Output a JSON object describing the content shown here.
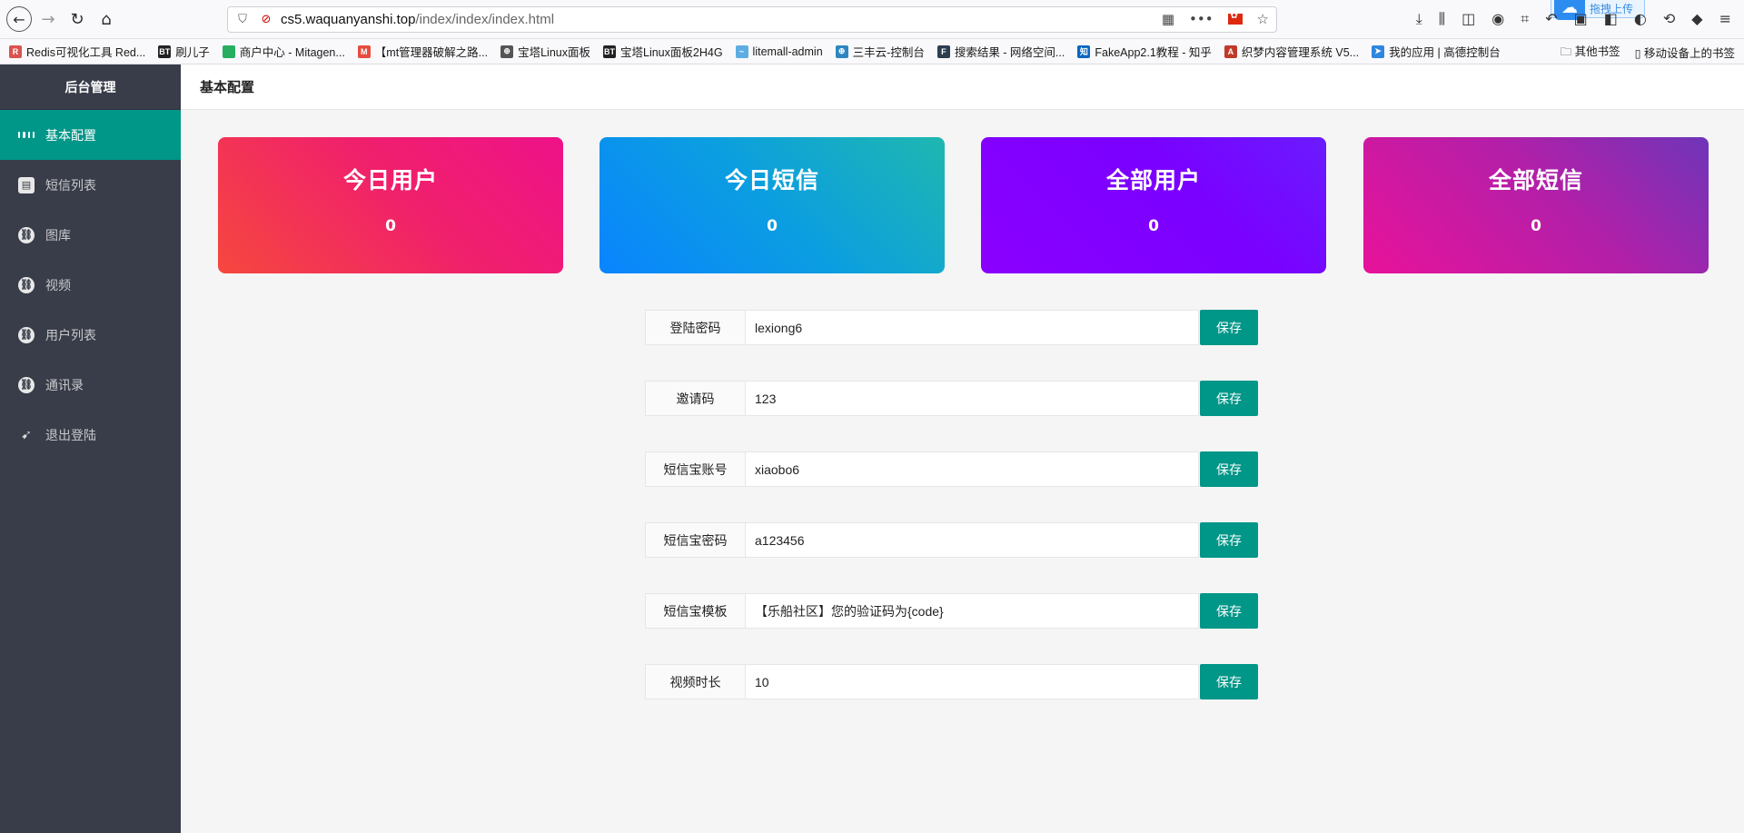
{
  "browser": {
    "url_host": "cs5.waquanyanshi.top",
    "url_path": "/index/index/index.html",
    "upload_chip": "拖拽上传"
  },
  "bookmarks": [
    {
      "label": "Redis可视化工具 Red...",
      "icon_color": "#d9534f",
      "icon_text": "R"
    },
    {
      "label": "刷儿子",
      "icon_color": "#222222",
      "icon_text": "BT"
    },
    {
      "label": "商户中心 - Mitagen...",
      "icon_color": "#27ae60",
      "icon_text": ""
    },
    {
      "label": "【mt管理器破解之路...",
      "icon_color": "#e74c3c",
      "icon_text": "M"
    },
    {
      "label": "宝塔Linux面板",
      "icon_color": "#555555",
      "icon_text": "⊕"
    },
    {
      "label": "宝塔Linux面板2H4G",
      "icon_color": "#222222",
      "icon_text": "BT"
    },
    {
      "label": "litemall-admin",
      "icon_color": "#5dade2",
      "icon_text": "~"
    },
    {
      "label": "三丰云-控制台",
      "icon_color": "#2e86c1",
      "icon_text": "⊕"
    },
    {
      "label": "搜索结果 - 网络空间...",
      "icon_color": "#2c3e50",
      "icon_text": "F"
    },
    {
      "label": "FakeApp2.1教程 - 知乎",
      "icon_color": "#0a66c2",
      "icon_text": "知"
    },
    {
      "label": "织梦内容管理系统 V5...",
      "icon_color": "#c0392b",
      "icon_text": "A"
    },
    {
      "label": "我的应用 | 高德控制台",
      "icon_color": "#2e86de",
      "icon_text": "➤"
    }
  ],
  "bookmarks_right": [
    "其他书签",
    "移动设备上的书签"
  ],
  "sidebar": {
    "title": "后台管理",
    "items": [
      {
        "label": "基本配置",
        "icon": "grid-icon"
      },
      {
        "label": "短信列表",
        "icon": "sms-list-icon"
      },
      {
        "label": "图库",
        "icon": "link-icon"
      },
      {
        "label": "视频",
        "icon": "link-icon"
      },
      {
        "label": "用户列表",
        "icon": "link-icon"
      },
      {
        "label": "通讯录",
        "icon": "link-icon"
      },
      {
        "label": "退出登陆",
        "icon": "logout-icon"
      }
    ]
  },
  "header": {
    "title": "基本配置"
  },
  "cards": [
    {
      "title": "今日用户",
      "value": "0"
    },
    {
      "title": "今日短信",
      "value": "0"
    },
    {
      "title": "全部用户",
      "value": "0"
    },
    {
      "title": "全部短信",
      "value": "0"
    }
  ],
  "form": [
    {
      "label": "登陆密码",
      "value": "lexiong6",
      "button": "保存"
    },
    {
      "label": "邀请码",
      "value": "123",
      "button": "保存"
    },
    {
      "label": "短信宝账号",
      "value": "xiaobo6",
      "button": "保存"
    },
    {
      "label": "短信宝密码",
      "value": "a123456",
      "button": "保存"
    },
    {
      "label": "短信宝模板",
      "value": "【乐船社区】您的验证码为{code}",
      "button": "保存"
    },
    {
      "label": "视频时长",
      "value": "10",
      "button": "保存"
    }
  ],
  "colors": {
    "accent": "#009688",
    "sidebar": "#393d49"
  }
}
